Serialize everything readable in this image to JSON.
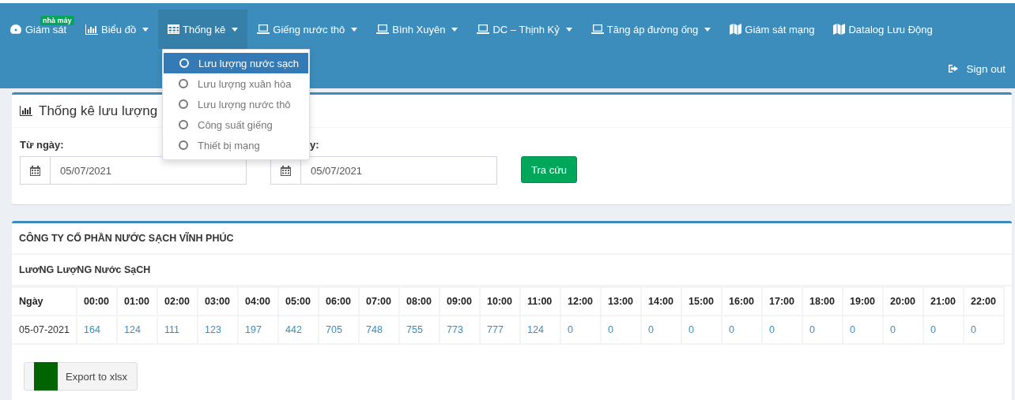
{
  "nav": {
    "items": [
      {
        "label": "Giám sát",
        "kind": "gauge",
        "badge": "nhà máy",
        "dropdown": false,
        "selected": false
      },
      {
        "label": "Biểu đồ",
        "kind": "bars",
        "dropdown": true,
        "selected": false
      },
      {
        "label": "Thống kê",
        "kind": "table",
        "dropdown": true,
        "selected": true
      },
      {
        "label": "Giếng nước thô",
        "kind": "laptop",
        "dropdown": true,
        "selected": false
      },
      {
        "label": "Bình Xuyên",
        "kind": "laptop",
        "dropdown": true,
        "selected": false
      },
      {
        "label": "DC – Thịnh Kỷ",
        "kind": "laptop",
        "dropdown": true,
        "selected": false
      },
      {
        "label": "Tăng áp đường ống",
        "kind": "laptop",
        "dropdown": true,
        "selected": false
      },
      {
        "label": "Giám sát mạng",
        "kind": "map",
        "dropdown": false,
        "selected": false
      },
      {
        "label": "Datalog Lưu Động",
        "kind": "map",
        "dropdown": false,
        "selected": false
      }
    ],
    "sign_out": "Sign out"
  },
  "dropdown": {
    "items": [
      {
        "label": "Lưu lượng nước sạch",
        "selected": true
      },
      {
        "label": "Lưu lượng xuân hòa",
        "selected": false
      },
      {
        "label": "Lưu lượng nước thô",
        "selected": false
      },
      {
        "label": "Công suất giếng",
        "selected": false
      },
      {
        "label": "Thiết bị mạng",
        "selected": false
      }
    ]
  },
  "filter": {
    "title": "Thống kê lưu lượng",
    "from_label": "Từ ngày:",
    "from_value": "05/07/2021",
    "to_label": "y:",
    "to_value": "05/07/2021",
    "search_button": "Tra cứu"
  },
  "report": {
    "company": "CÔNG TY CỔ PHẦN NƯỚC SẠCH VĨNH PHÚC",
    "subtitle": "LươNG LượNG Nước SạCH",
    "table": {
      "columns": [
        "Ngày",
        "00:00",
        "01:00",
        "02:00",
        "03:00",
        "04:00",
        "05:00",
        "06:00",
        "07:00",
        "08:00",
        "09:00",
        "10:00",
        "11:00",
        "12:00",
        "13:00",
        "14:00",
        "15:00",
        "16:00",
        "17:00",
        "18:00",
        "19:00",
        "20:00",
        "21:00",
        "22:00"
      ],
      "rows": [
        {
          "date": "05-07-2021",
          "values": [
            "164",
            "124",
            "111",
            "123",
            "197",
            "442",
            "705",
            "748",
            "755",
            "773",
            "777",
            "124",
            "0",
            "0",
            "0",
            "0",
            "0",
            "0",
            "0",
            "0",
            "0",
            "0",
            "0"
          ]
        }
      ]
    },
    "export_button": "Export to xlsx"
  }
}
